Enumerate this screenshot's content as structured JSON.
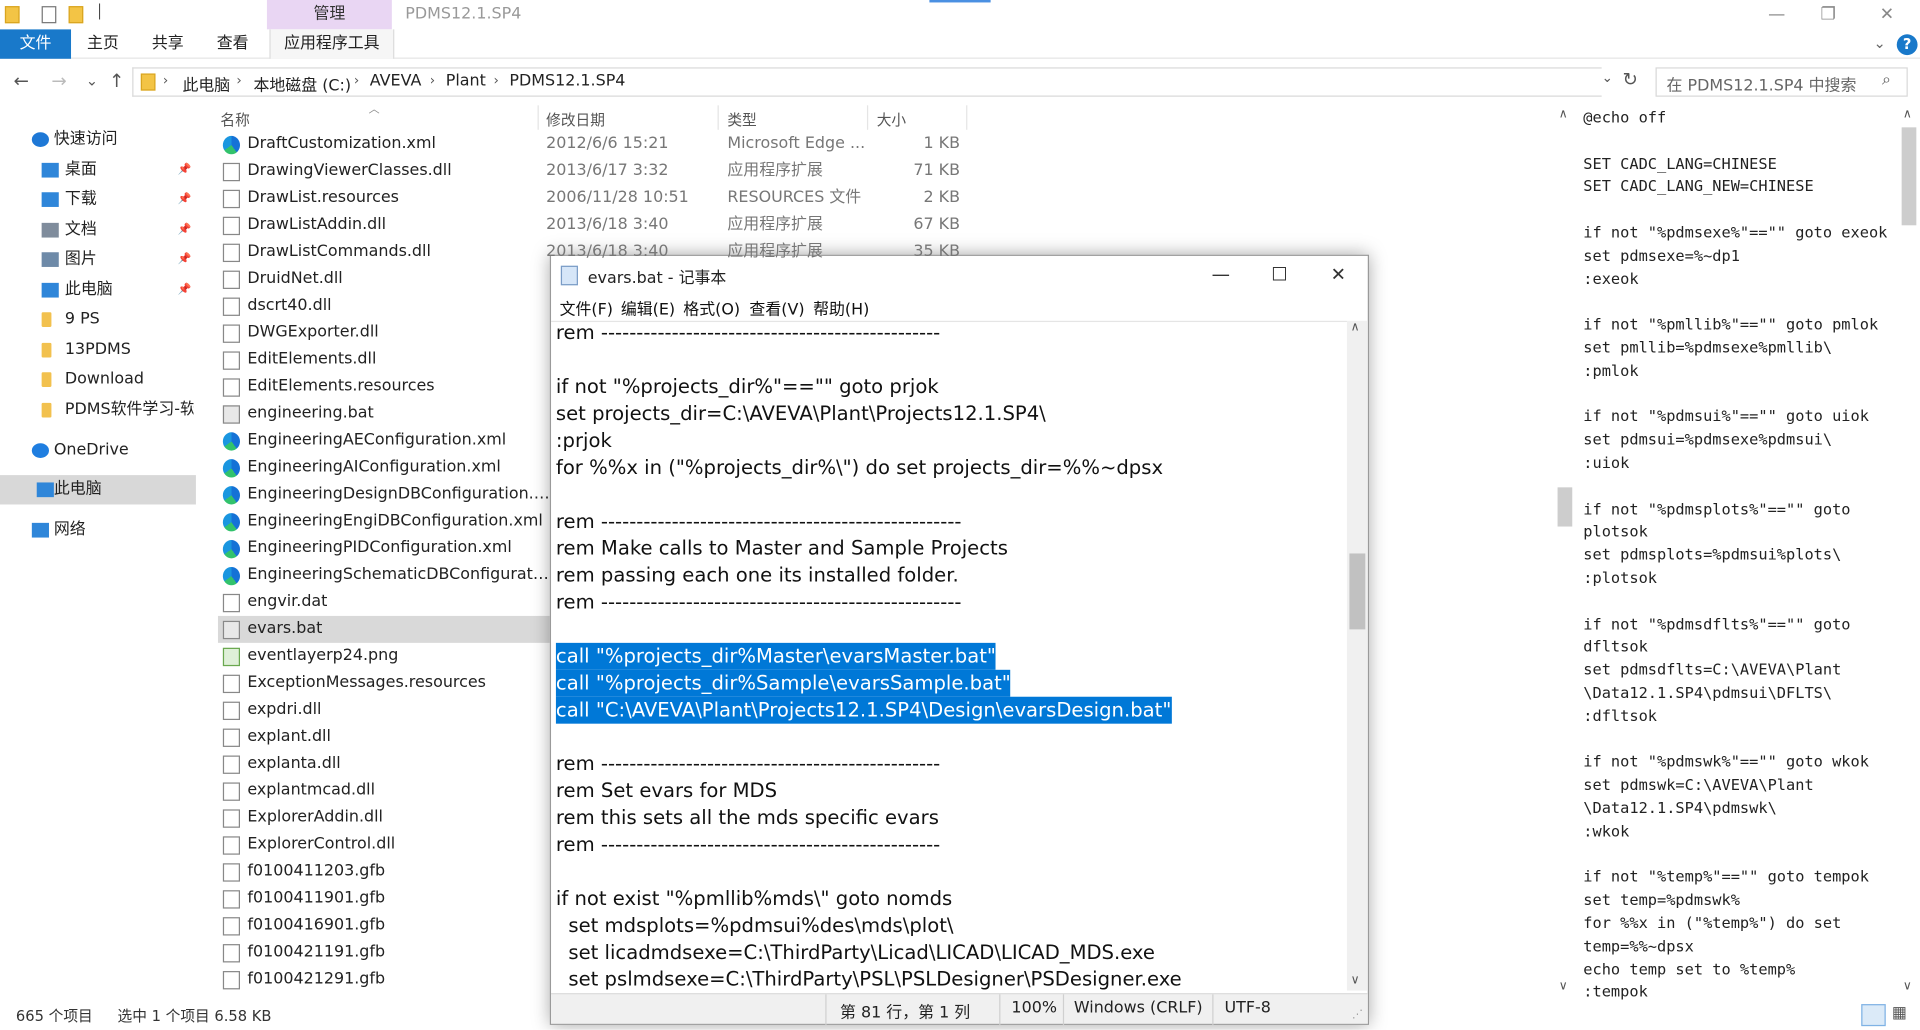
{
  "window": {
    "title": "PDMS12.1.SP4",
    "context_tab": "管理",
    "minimize": "—",
    "restore": "❐",
    "close": "✕"
  },
  "ribbon": {
    "tabs": [
      "文件",
      "主页",
      "共享",
      "查看",
      "应用程序工具"
    ],
    "chevron": "⌄",
    "help": "?"
  },
  "nav": {
    "back": "←",
    "forward": "→",
    "recent": "⌄",
    "up": "↑"
  },
  "breadcrumb": [
    "此电脑",
    "本地磁盘 (C:)",
    "AVEVA",
    "Plant",
    "PDMS12.1.SP4"
  ],
  "address_dropdown": "⌄",
  "refresh": "↻",
  "search": {
    "placeholder": "在 PDMS12.1.SP4 中搜索",
    "icon": "⌕"
  },
  "sidebar": [
    {
      "label": "快速访问",
      "icon": "star-icon",
      "color": "#1e78d6",
      "pin": false,
      "selected": false
    },
    {
      "label": "桌面",
      "icon": "desktop-icon",
      "color": "#2f86d9",
      "pin": true,
      "selected": false
    },
    {
      "label": "下载",
      "icon": "download-icon",
      "color": "#2f86d9",
      "pin": true,
      "selected": false
    },
    {
      "label": "文档",
      "icon": "document-icon",
      "color": "#7f8c9c",
      "pin": true,
      "selected": false
    },
    {
      "label": "图片",
      "icon": "pictures-icon",
      "color": "#6e8aa8",
      "pin": true,
      "selected": false
    },
    {
      "label": "此电脑",
      "icon": "computer-icon",
      "color": "#2f86d9",
      "pin": true,
      "selected": false
    },
    {
      "label": "9 PS",
      "icon": "folder-icon",
      "color": "#f2c14e",
      "pin": false,
      "selected": false
    },
    {
      "label": "13PDMS",
      "icon": "folder-icon",
      "color": "#f2c14e",
      "pin": false,
      "selected": false
    },
    {
      "label": "Download",
      "icon": "folder-icon",
      "color": "#f2c14e",
      "pin": false,
      "selected": false
    },
    {
      "label": "PDMS软件学习-软件",
      "icon": "folder-icon",
      "color": "#f2c14e",
      "pin": false,
      "selected": false
    },
    {
      "label": "OneDrive",
      "icon": "cloud-icon",
      "color": "#1f7ee0",
      "pin": false,
      "selected": false
    },
    {
      "label": "此电脑",
      "icon": "computer-icon",
      "color": "#2f86d9",
      "pin": false,
      "selected": true
    },
    {
      "label": "网络",
      "icon": "network-icon",
      "color": "#2f86d9",
      "pin": false,
      "selected": false
    }
  ],
  "columns": {
    "name": "名称",
    "date": "修改日期",
    "type": "类型",
    "size": "大小"
  },
  "files": [
    {
      "name": "DraftCustomization.xml",
      "icon": "edge-icon",
      "date": "2012/6/6 15:21",
      "type": "Microsoft Edge ...",
      "size": "1 KB"
    },
    {
      "name": "DrawingViewerClasses.dll",
      "icon": "dll-icon",
      "date": "2013/6/17 3:32",
      "type": "应用程序扩展",
      "size": "71 KB"
    },
    {
      "name": "DrawList.resources",
      "icon": "file-icon",
      "date": "2006/11/28 10:51",
      "type": "RESOURCES 文件",
      "size": "2 KB"
    },
    {
      "name": "DrawListAddin.dll",
      "icon": "dll-icon",
      "date": "2013/6/18 3:40",
      "type": "应用程序扩展",
      "size": "67 KB"
    },
    {
      "name": "DrawListCommands.dll",
      "icon": "dll-icon",
      "date": "2013/6/18 3:40",
      "type": "应用程序扩展",
      "size": "35 KB"
    },
    {
      "name": "DruidNet.dll",
      "icon": "dll-icon"
    },
    {
      "name": "dscrt40.dll",
      "icon": "dll-icon"
    },
    {
      "name": "DWGExporter.dll",
      "icon": "dll-icon"
    },
    {
      "name": "EditElements.dll",
      "icon": "dll-icon"
    },
    {
      "name": "EditElements.resources",
      "icon": "file-icon"
    },
    {
      "name": "engineering.bat",
      "icon": "bat-icon"
    },
    {
      "name": "EngineeringAEConfiguration.xml",
      "icon": "edge-icon"
    },
    {
      "name": "EngineeringAIConfiguration.xml",
      "icon": "edge-icon"
    },
    {
      "name": "EngineeringDesignDBConfiguration.x...",
      "icon": "edge-icon"
    },
    {
      "name": "EngineeringEngiDBConfiguration.xml",
      "icon": "edge-icon"
    },
    {
      "name": "EngineeringPIDConfiguration.xml",
      "icon": "edge-icon"
    },
    {
      "name": "EngineeringSchematicDBConfigurati...",
      "icon": "edge-icon"
    },
    {
      "name": "engvir.dat",
      "icon": "file-icon"
    },
    {
      "name": "evars.bat",
      "icon": "bat-icon",
      "selected": true
    },
    {
      "name": "eventlayerp24.png",
      "icon": "png-icon"
    },
    {
      "name": "ExceptionMessages.resources",
      "icon": "file-icon"
    },
    {
      "name": "expdri.dll",
      "icon": "dll-icon"
    },
    {
      "name": "explant.dll",
      "icon": "dll-icon"
    },
    {
      "name": "explanta.dll",
      "icon": "dll-icon"
    },
    {
      "name": "explantmcad.dll",
      "icon": "dll-icon"
    },
    {
      "name": "ExplorerAddin.dll",
      "icon": "dll-icon"
    },
    {
      "name": "ExplorerControl.dll",
      "icon": "dll-icon"
    },
    {
      "name": "f0100411203.gfb",
      "icon": "file-icon"
    },
    {
      "name": "f0100411901.gfb",
      "icon": "file-icon"
    },
    {
      "name": "f0100416901.gfb",
      "icon": "file-icon"
    },
    {
      "name": "f0100421191.gfb",
      "icon": "file-icon"
    },
    {
      "name": "f0100421291.gfb",
      "icon": "file-icon"
    }
  ],
  "status": {
    "count": "665 个项目",
    "selection": "选中 1 个项目  6.58 KB"
  },
  "preview_lines": [
    "@echo off",
    "",
    "SET CADC_LANG=CHINESE",
    "SET CADC_LANG_NEW=CHINESE",
    "",
    "if not \"%pdmsexe%\"==\"\" goto exeok",
    "set pdmsexe=%~dp1",
    ":exeok",
    "",
    "if not \"%pmllib%\"==\"\" goto pmlok",
    "set pmllib=%pdmsexe%pmllib\\",
    ":pmlok",
    "",
    "if not \"%pdmsui%\"==\"\" goto uiok",
    "set pdmsui=%pdmsexe%pdmsui\\",
    ":uiok",
    "",
    "if not \"%pdmsplots%\"==\"\" goto",
    "plotsok",
    "set pdmsplots=%pdmsui%plots\\",
    ":plotsok",
    "",
    "if not \"%pdmsdflts%\"==\"\" goto",
    "dfltsok",
    "set pdmsdflts=C:\\AVEVA\\Plant",
    "\\Data12.1.SP4\\pdmsui\\DFLTS\\",
    ":dfltsok",
    "",
    "if not \"%pdmswk%\"==\"\" goto wkok",
    "set pdmswk=C:\\AVEVA\\Plant",
    "\\Data12.1.SP4\\pdmswk\\",
    ":wkok",
    "",
    "if not \"%temp%\"==\"\" goto tempok",
    "set temp=%pdmswk%",
    "for %%x in (\"%temp%\") do set",
    "temp=%%~dpsx",
    "echo temp set to %temp%",
    ":tempok"
  ],
  "notepad": {
    "title": "evars.bat - 记事本",
    "minimize": "—",
    "maximize": "☐",
    "close": "✕",
    "menu": [
      "文件(F)",
      "编辑(E)",
      "格式(O)",
      "查看(V)",
      "帮助(H)"
    ],
    "lines": [
      {
        "text": "rem ------------------------------------------------"
      },
      {
        "text": ""
      },
      {
        "text": "if not \"%projects_dir%\"==\"\" goto prjok"
      },
      {
        "text": "set projects_dir=C:\\AVEVA\\Plant\\Projects12.1.SP4\\"
      },
      {
        "text": ":prjok"
      },
      {
        "text": "for %%x in (\"%projects_dir%\\\") do set projects_dir=%%~dpsx"
      },
      {
        "text": ""
      },
      {
        "text": "rem ---------------------------------------------------"
      },
      {
        "text": "rem Make calls to Master and Sample Projects"
      },
      {
        "text": "rem passing each one its installed folder."
      },
      {
        "text": "rem ---------------------------------------------------"
      },
      {
        "text": ""
      },
      {
        "text": "call \"%projects_dir%Master\\evarsMaster.bat\"",
        "selected": true
      },
      {
        "text": "call \"%projects_dir%Sample\\evarsSample.bat\"",
        "selected": true
      },
      {
        "text": "call \"C:\\AVEVA\\Plant\\Projects12.1.SP4\\Design\\evarsDesign.bat\"",
        "selected": true
      },
      {
        "text": ""
      },
      {
        "text": "rem ------------------------------------------------"
      },
      {
        "text": "rem Set evars for MDS"
      },
      {
        "text": "rem this sets all the mds specific evars"
      },
      {
        "text": "rem ------------------------------------------------"
      },
      {
        "text": ""
      },
      {
        "text": "if not exist \"%pmllib%mds\\\" goto nomds"
      },
      {
        "text": "  set mdsplots=%pdmsui%des\\mds\\plot\\"
      },
      {
        "text": "  set licadmdsexe=C:\\ThirdParty\\Licad\\LICAD\\LICAD_MDS.exe"
      },
      {
        "text": "  set pslmdsexe=C:\\ThirdParty\\PSL\\PSLDesigner\\PSDesigner.exe"
      }
    ],
    "status": {
      "position": "第 81 行，第 1 列",
      "zoom": "100%",
      "eol": "Windows (CRLF)",
      "encoding": "UTF-8"
    }
  }
}
